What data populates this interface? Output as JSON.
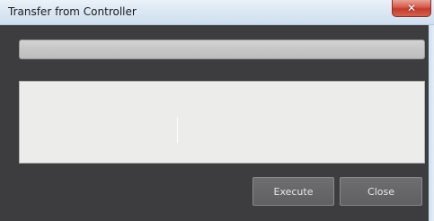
{
  "window": {
    "title": "Transfer from Controller",
    "close_glyph": "✕"
  },
  "progress": {
    "value_percent": 0
  },
  "log": {
    "text": ""
  },
  "buttons": {
    "execute_label": "Execute",
    "close_label": "Close"
  },
  "colors": {
    "client_background": "#3d3d3f",
    "button_face": "#666669",
    "title_bar": "#dce8f4",
    "close_button": "#c94a3b"
  },
  "icons": {
    "close": "close-icon"
  }
}
